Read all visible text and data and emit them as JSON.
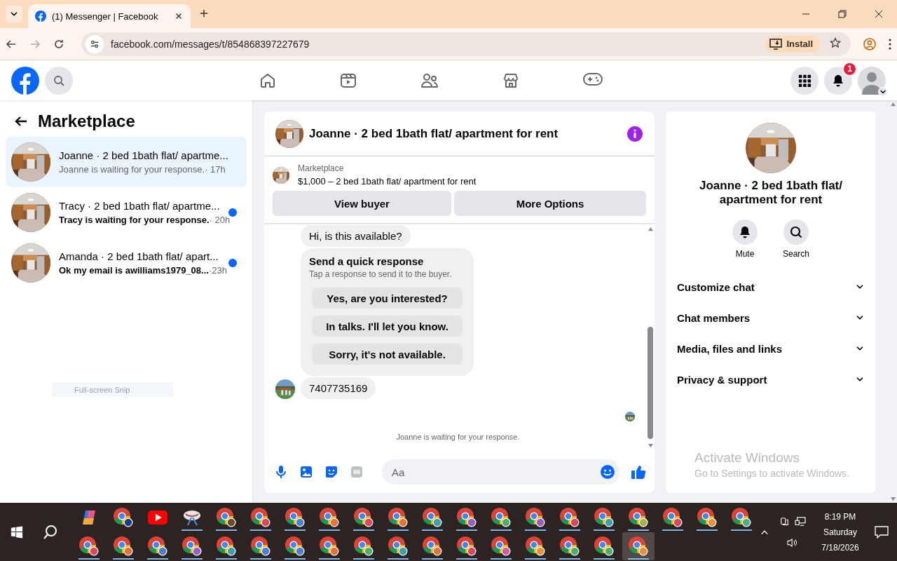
{
  "browser": {
    "tab_title": "(1) Messenger | Facebook",
    "url": "facebook.com/messages/t/854868397227679",
    "install_label": "Install"
  },
  "header": {
    "notification_count": "1"
  },
  "sidebar": {
    "title": "Marketplace",
    "conversations": [
      {
        "title": "Joanne · 2 bed 1bath flat/ apartme...",
        "preview": "Joanne is waiting for your response.",
        "time": "· 17h",
        "unread": false,
        "selected": true
      },
      {
        "title": "Tracy · 2 bed 1bath flat/ apartme...",
        "preview": "Tracy is waiting for your response.",
        "time": "· 20h",
        "unread": true,
        "selected": false
      },
      {
        "title": "Amanda · 2 bed 1bath flat/ apart...",
        "preview": "Ok my email is awilliams1979_08...",
        "time": "·23h",
        "unread": true,
        "selected": false
      }
    ]
  },
  "chat": {
    "title": "Joanne · 2 bed 1bath flat/ apartment for rent",
    "listing": {
      "label": "Marketplace",
      "text": "$1,000 – 2 bed 1bath flat/ apartment for rent"
    },
    "buttons": [
      "View buyer",
      "More Options"
    ],
    "messages": [
      {
        "kind": "text",
        "text": "Hi, is this available?",
        "avatar": false
      },
      {
        "kind": "quick_response",
        "title": "Send a quick response",
        "subtitle": "Tap a response to send it to the buyer.",
        "options": [
          "Yes, are you interested?",
          "In talks. I'll let you know.",
          "Sorry, it's not available."
        ]
      },
      {
        "kind": "text",
        "text": "7407735169",
        "avatar": true
      }
    ],
    "seen": true,
    "status": "Joanne is waiting for your response.",
    "composer": {
      "placeholder": "Aa"
    }
  },
  "details": {
    "title": "Joanne · 2 bed 1bath flat/ apartment for rent",
    "actions": [
      {
        "kind": "mute",
        "label": "Mute"
      },
      {
        "kind": "search",
        "label": "Search"
      }
    ],
    "sections": [
      {
        "label": "Customize chat",
        "expanded": false
      },
      {
        "label": "Chat members",
        "expanded": false
      },
      {
        "label": "Media, files and links",
        "expanded": false
      },
      {
        "label": "Privacy & support",
        "expanded": false
      }
    ]
  },
  "overlays": {
    "snip_label": "Full-screen Snip",
    "activation_title": "Activate Windows",
    "activation_text": "Go to Settings to activate Windows."
  },
  "taskbar": {
    "time": "8:19 PM",
    "day": "Saturday",
    "date": "7/18/2026",
    "apps": [
      {
        "kind": "copilot",
        "running": false,
        "selected": false
      },
      {
        "kind": "chrome",
        "color": "#1a3a8a",
        "running": false,
        "selected": false
      },
      {
        "kind": "youtube",
        "running": false,
        "selected": false
      },
      {
        "kind": "snip",
        "running": true,
        "selected": false
      },
      {
        "kind": "chrome",
        "color": "#6b4a2e",
        "running": true,
        "selected": false
      },
      {
        "kind": "chrome",
        "color": "#e0435a",
        "running": true,
        "selected": false
      },
      {
        "kind": "chrome",
        "color": "#4a7fd4",
        "running": true,
        "selected": false
      },
      {
        "kind": "chrome",
        "color": "#e8703a",
        "running": true,
        "selected": false
      },
      {
        "kind": "chrome",
        "color": "#e0435b",
        "running": true,
        "selected": false
      },
      {
        "kind": "chrome",
        "color": "#e8703b",
        "running": true,
        "selected": false
      },
      {
        "kind": "chrome",
        "color": "#3aa0a8",
        "running": true,
        "selected": false
      },
      {
        "kind": "chrome",
        "color": "#9a5cc8",
        "running": true,
        "selected": false
      },
      {
        "kind": "chrome",
        "color": "#4caf6a",
        "running": true,
        "selected": false
      },
      {
        "kind": "chrome",
        "color": "#9a5cc9",
        "running": true,
        "selected": false
      },
      {
        "kind": "chrome",
        "color": "#e0435c",
        "running": true,
        "selected": false
      },
      {
        "kind": "chrome",
        "color": "#3aa0a9",
        "running": true,
        "selected": false
      },
      {
        "kind": "chrome",
        "color": "#a8b04a",
        "running": true,
        "selected": false
      },
      {
        "kind": "chrome",
        "color": "#e0435d",
        "running": true,
        "selected": false
      },
      {
        "kind": "chrome",
        "color": "#e8903a",
        "running": true,
        "selected": false
      },
      {
        "kind": "chrome",
        "color": "#4caf8a",
        "running": true,
        "selected": false
      },
      {
        "kind": "chrome",
        "color": "#e0435e",
        "running": true,
        "selected": false
      },
      {
        "kind": "chrome",
        "color": "#e8703c",
        "running": true,
        "selected": false
      },
      {
        "kind": "chrome",
        "color": "#4a7fd5",
        "running": true,
        "selected": false
      },
      {
        "kind": "chrome",
        "color": "#9a5cca",
        "running": true,
        "selected": false
      },
      {
        "kind": "chrome",
        "color": "#3aa0aa",
        "running": true,
        "selected": false
      },
      {
        "kind": "chrome",
        "color": "#4a7fd6",
        "running": true,
        "selected": false
      },
      {
        "kind": "chrome",
        "color": "#4a7fd7",
        "running": true,
        "selected": false
      },
      {
        "kind": "chrome",
        "color": "#e8703d",
        "running": true,
        "selected": false
      },
      {
        "kind": "chrome",
        "color": "#4caf6b",
        "running": true,
        "selected": false
      },
      {
        "kind": "chrome",
        "color": "#3aa0ab",
        "running": true,
        "selected": false
      },
      {
        "kind": "chrome",
        "color": "#e8703e",
        "running": true,
        "selected": false
      },
      {
        "kind": "chrome",
        "color": "#e0435f",
        "running": true,
        "selected": false
      },
      {
        "kind": "chrome",
        "color": "#d85a9a",
        "running": true,
        "selected": false
      },
      {
        "kind": "chrome",
        "color": "#e8903b",
        "running": true,
        "selected": false
      },
      {
        "kind": "chrome",
        "color": "#4caf6c",
        "running": true,
        "selected": false
      },
      {
        "kind": "chrome",
        "color": "#4caf6d",
        "running": true,
        "selected": false
      },
      {
        "kind": "chrome",
        "color": "#e8903c",
        "running": true,
        "selected": true
      }
    ]
  }
}
